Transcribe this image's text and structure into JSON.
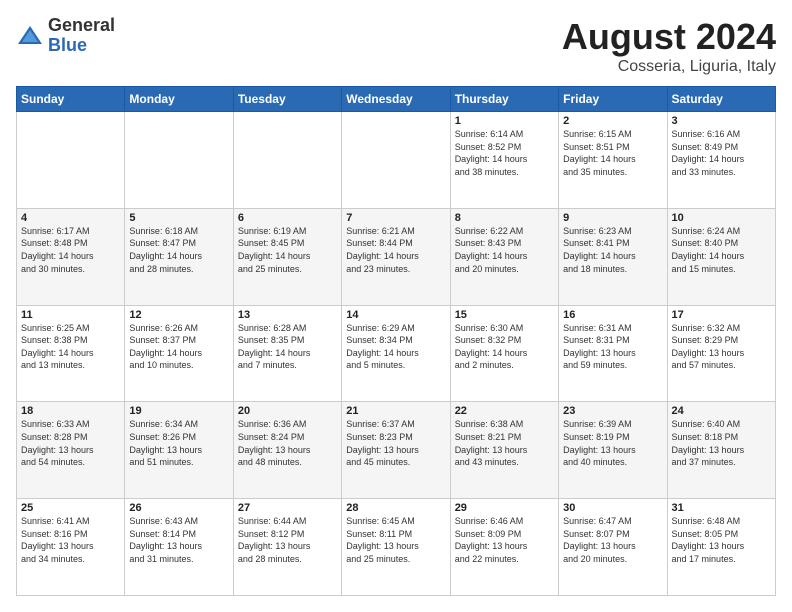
{
  "logo": {
    "general": "General",
    "blue": "Blue"
  },
  "header": {
    "title": "August 2024",
    "subtitle": "Cosseria, Liguria, Italy"
  },
  "weekdays": [
    "Sunday",
    "Monday",
    "Tuesday",
    "Wednesday",
    "Thursday",
    "Friday",
    "Saturday"
  ],
  "weeks": [
    [
      {
        "day": "",
        "info": ""
      },
      {
        "day": "",
        "info": ""
      },
      {
        "day": "",
        "info": ""
      },
      {
        "day": "",
        "info": ""
      },
      {
        "day": "1",
        "info": "Sunrise: 6:14 AM\nSunset: 8:52 PM\nDaylight: 14 hours\nand 38 minutes."
      },
      {
        "day": "2",
        "info": "Sunrise: 6:15 AM\nSunset: 8:51 PM\nDaylight: 14 hours\nand 35 minutes."
      },
      {
        "day": "3",
        "info": "Sunrise: 6:16 AM\nSunset: 8:49 PM\nDaylight: 14 hours\nand 33 minutes."
      }
    ],
    [
      {
        "day": "4",
        "info": "Sunrise: 6:17 AM\nSunset: 8:48 PM\nDaylight: 14 hours\nand 30 minutes."
      },
      {
        "day": "5",
        "info": "Sunrise: 6:18 AM\nSunset: 8:47 PM\nDaylight: 14 hours\nand 28 minutes."
      },
      {
        "day": "6",
        "info": "Sunrise: 6:19 AM\nSunset: 8:45 PM\nDaylight: 14 hours\nand 25 minutes."
      },
      {
        "day": "7",
        "info": "Sunrise: 6:21 AM\nSunset: 8:44 PM\nDaylight: 14 hours\nand 23 minutes."
      },
      {
        "day": "8",
        "info": "Sunrise: 6:22 AM\nSunset: 8:43 PM\nDaylight: 14 hours\nand 20 minutes."
      },
      {
        "day": "9",
        "info": "Sunrise: 6:23 AM\nSunset: 8:41 PM\nDaylight: 14 hours\nand 18 minutes."
      },
      {
        "day": "10",
        "info": "Sunrise: 6:24 AM\nSunset: 8:40 PM\nDaylight: 14 hours\nand 15 minutes."
      }
    ],
    [
      {
        "day": "11",
        "info": "Sunrise: 6:25 AM\nSunset: 8:38 PM\nDaylight: 14 hours\nand 13 minutes."
      },
      {
        "day": "12",
        "info": "Sunrise: 6:26 AM\nSunset: 8:37 PM\nDaylight: 14 hours\nand 10 minutes."
      },
      {
        "day": "13",
        "info": "Sunrise: 6:28 AM\nSunset: 8:35 PM\nDaylight: 14 hours\nand 7 minutes."
      },
      {
        "day": "14",
        "info": "Sunrise: 6:29 AM\nSunset: 8:34 PM\nDaylight: 14 hours\nand 5 minutes."
      },
      {
        "day": "15",
        "info": "Sunrise: 6:30 AM\nSunset: 8:32 PM\nDaylight: 14 hours\nand 2 minutes."
      },
      {
        "day": "16",
        "info": "Sunrise: 6:31 AM\nSunset: 8:31 PM\nDaylight: 13 hours\nand 59 minutes."
      },
      {
        "day": "17",
        "info": "Sunrise: 6:32 AM\nSunset: 8:29 PM\nDaylight: 13 hours\nand 57 minutes."
      }
    ],
    [
      {
        "day": "18",
        "info": "Sunrise: 6:33 AM\nSunset: 8:28 PM\nDaylight: 13 hours\nand 54 minutes."
      },
      {
        "day": "19",
        "info": "Sunrise: 6:34 AM\nSunset: 8:26 PM\nDaylight: 13 hours\nand 51 minutes."
      },
      {
        "day": "20",
        "info": "Sunrise: 6:36 AM\nSunset: 8:24 PM\nDaylight: 13 hours\nand 48 minutes."
      },
      {
        "day": "21",
        "info": "Sunrise: 6:37 AM\nSunset: 8:23 PM\nDaylight: 13 hours\nand 45 minutes."
      },
      {
        "day": "22",
        "info": "Sunrise: 6:38 AM\nSunset: 8:21 PM\nDaylight: 13 hours\nand 43 minutes."
      },
      {
        "day": "23",
        "info": "Sunrise: 6:39 AM\nSunset: 8:19 PM\nDaylight: 13 hours\nand 40 minutes."
      },
      {
        "day": "24",
        "info": "Sunrise: 6:40 AM\nSunset: 8:18 PM\nDaylight: 13 hours\nand 37 minutes."
      }
    ],
    [
      {
        "day": "25",
        "info": "Sunrise: 6:41 AM\nSunset: 8:16 PM\nDaylight: 13 hours\nand 34 minutes."
      },
      {
        "day": "26",
        "info": "Sunrise: 6:43 AM\nSunset: 8:14 PM\nDaylight: 13 hours\nand 31 minutes."
      },
      {
        "day": "27",
        "info": "Sunrise: 6:44 AM\nSunset: 8:12 PM\nDaylight: 13 hours\nand 28 minutes."
      },
      {
        "day": "28",
        "info": "Sunrise: 6:45 AM\nSunset: 8:11 PM\nDaylight: 13 hours\nand 25 minutes."
      },
      {
        "day": "29",
        "info": "Sunrise: 6:46 AM\nSunset: 8:09 PM\nDaylight: 13 hours\nand 22 minutes."
      },
      {
        "day": "30",
        "info": "Sunrise: 6:47 AM\nSunset: 8:07 PM\nDaylight: 13 hours\nand 20 minutes."
      },
      {
        "day": "31",
        "info": "Sunrise: 6:48 AM\nSunset: 8:05 PM\nDaylight: 13 hours\nand 17 minutes."
      }
    ]
  ]
}
